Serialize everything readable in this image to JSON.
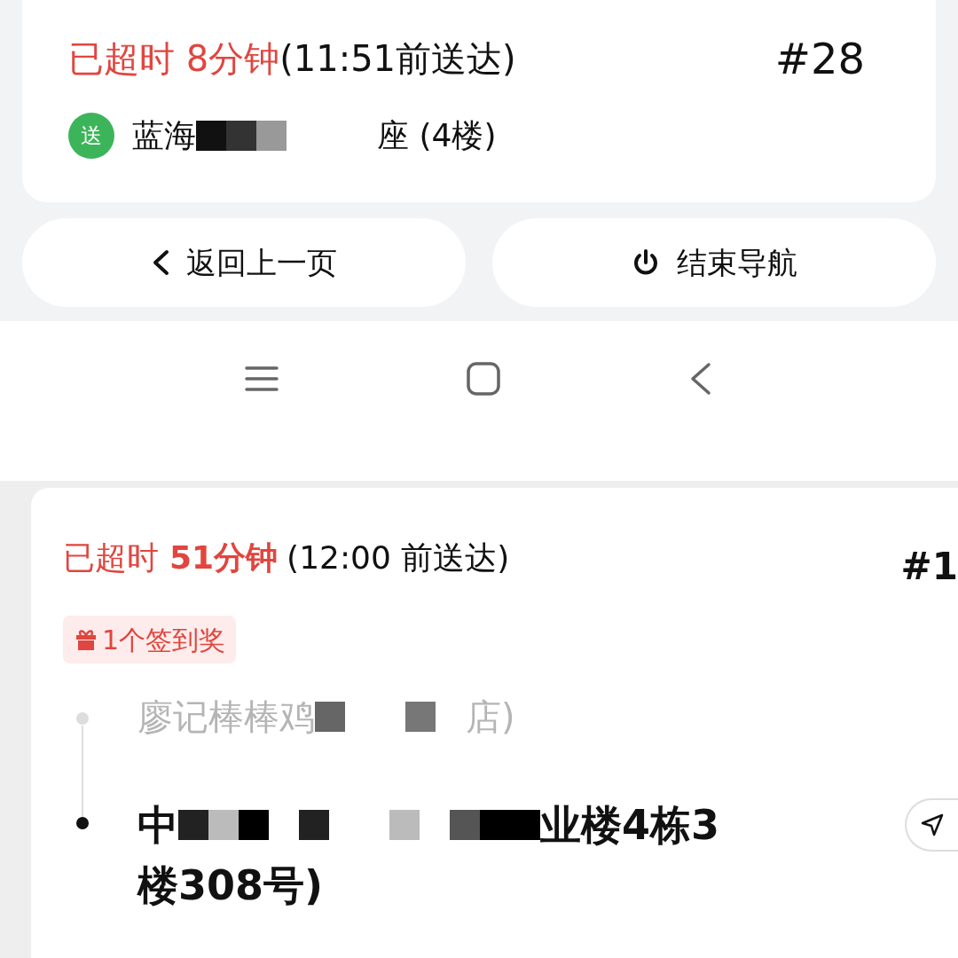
{
  "order_1": {
    "overdue_label": "已超时 8分钟",
    "deadline": "(11:51前送达)",
    "number": "#28",
    "badge": "送",
    "address_start": "蓝海",
    "address_end": "座 (4楼)"
  },
  "buttons": [
    {
      "kind": "back",
      "label": "返回上一页"
    },
    {
      "kind": "power",
      "label": "结束导航"
    }
  ],
  "nav_bar": [
    {
      "kind": "menu"
    },
    {
      "kind": "home"
    },
    {
      "kind": "back"
    }
  ],
  "order_2": {
    "overdue_prefix": "已超时",
    "overdue_minutes": "51分钟",
    "deadline": "(12:00 前送达)",
    "number": "#1",
    "reward": "1个签到奖",
    "shop_start": "廖记棒棒鸡",
    "shop_end": "店)",
    "address_start": "中",
    "address_end": "业楼4栋3",
    "address_line_2": "楼308号)"
  }
}
